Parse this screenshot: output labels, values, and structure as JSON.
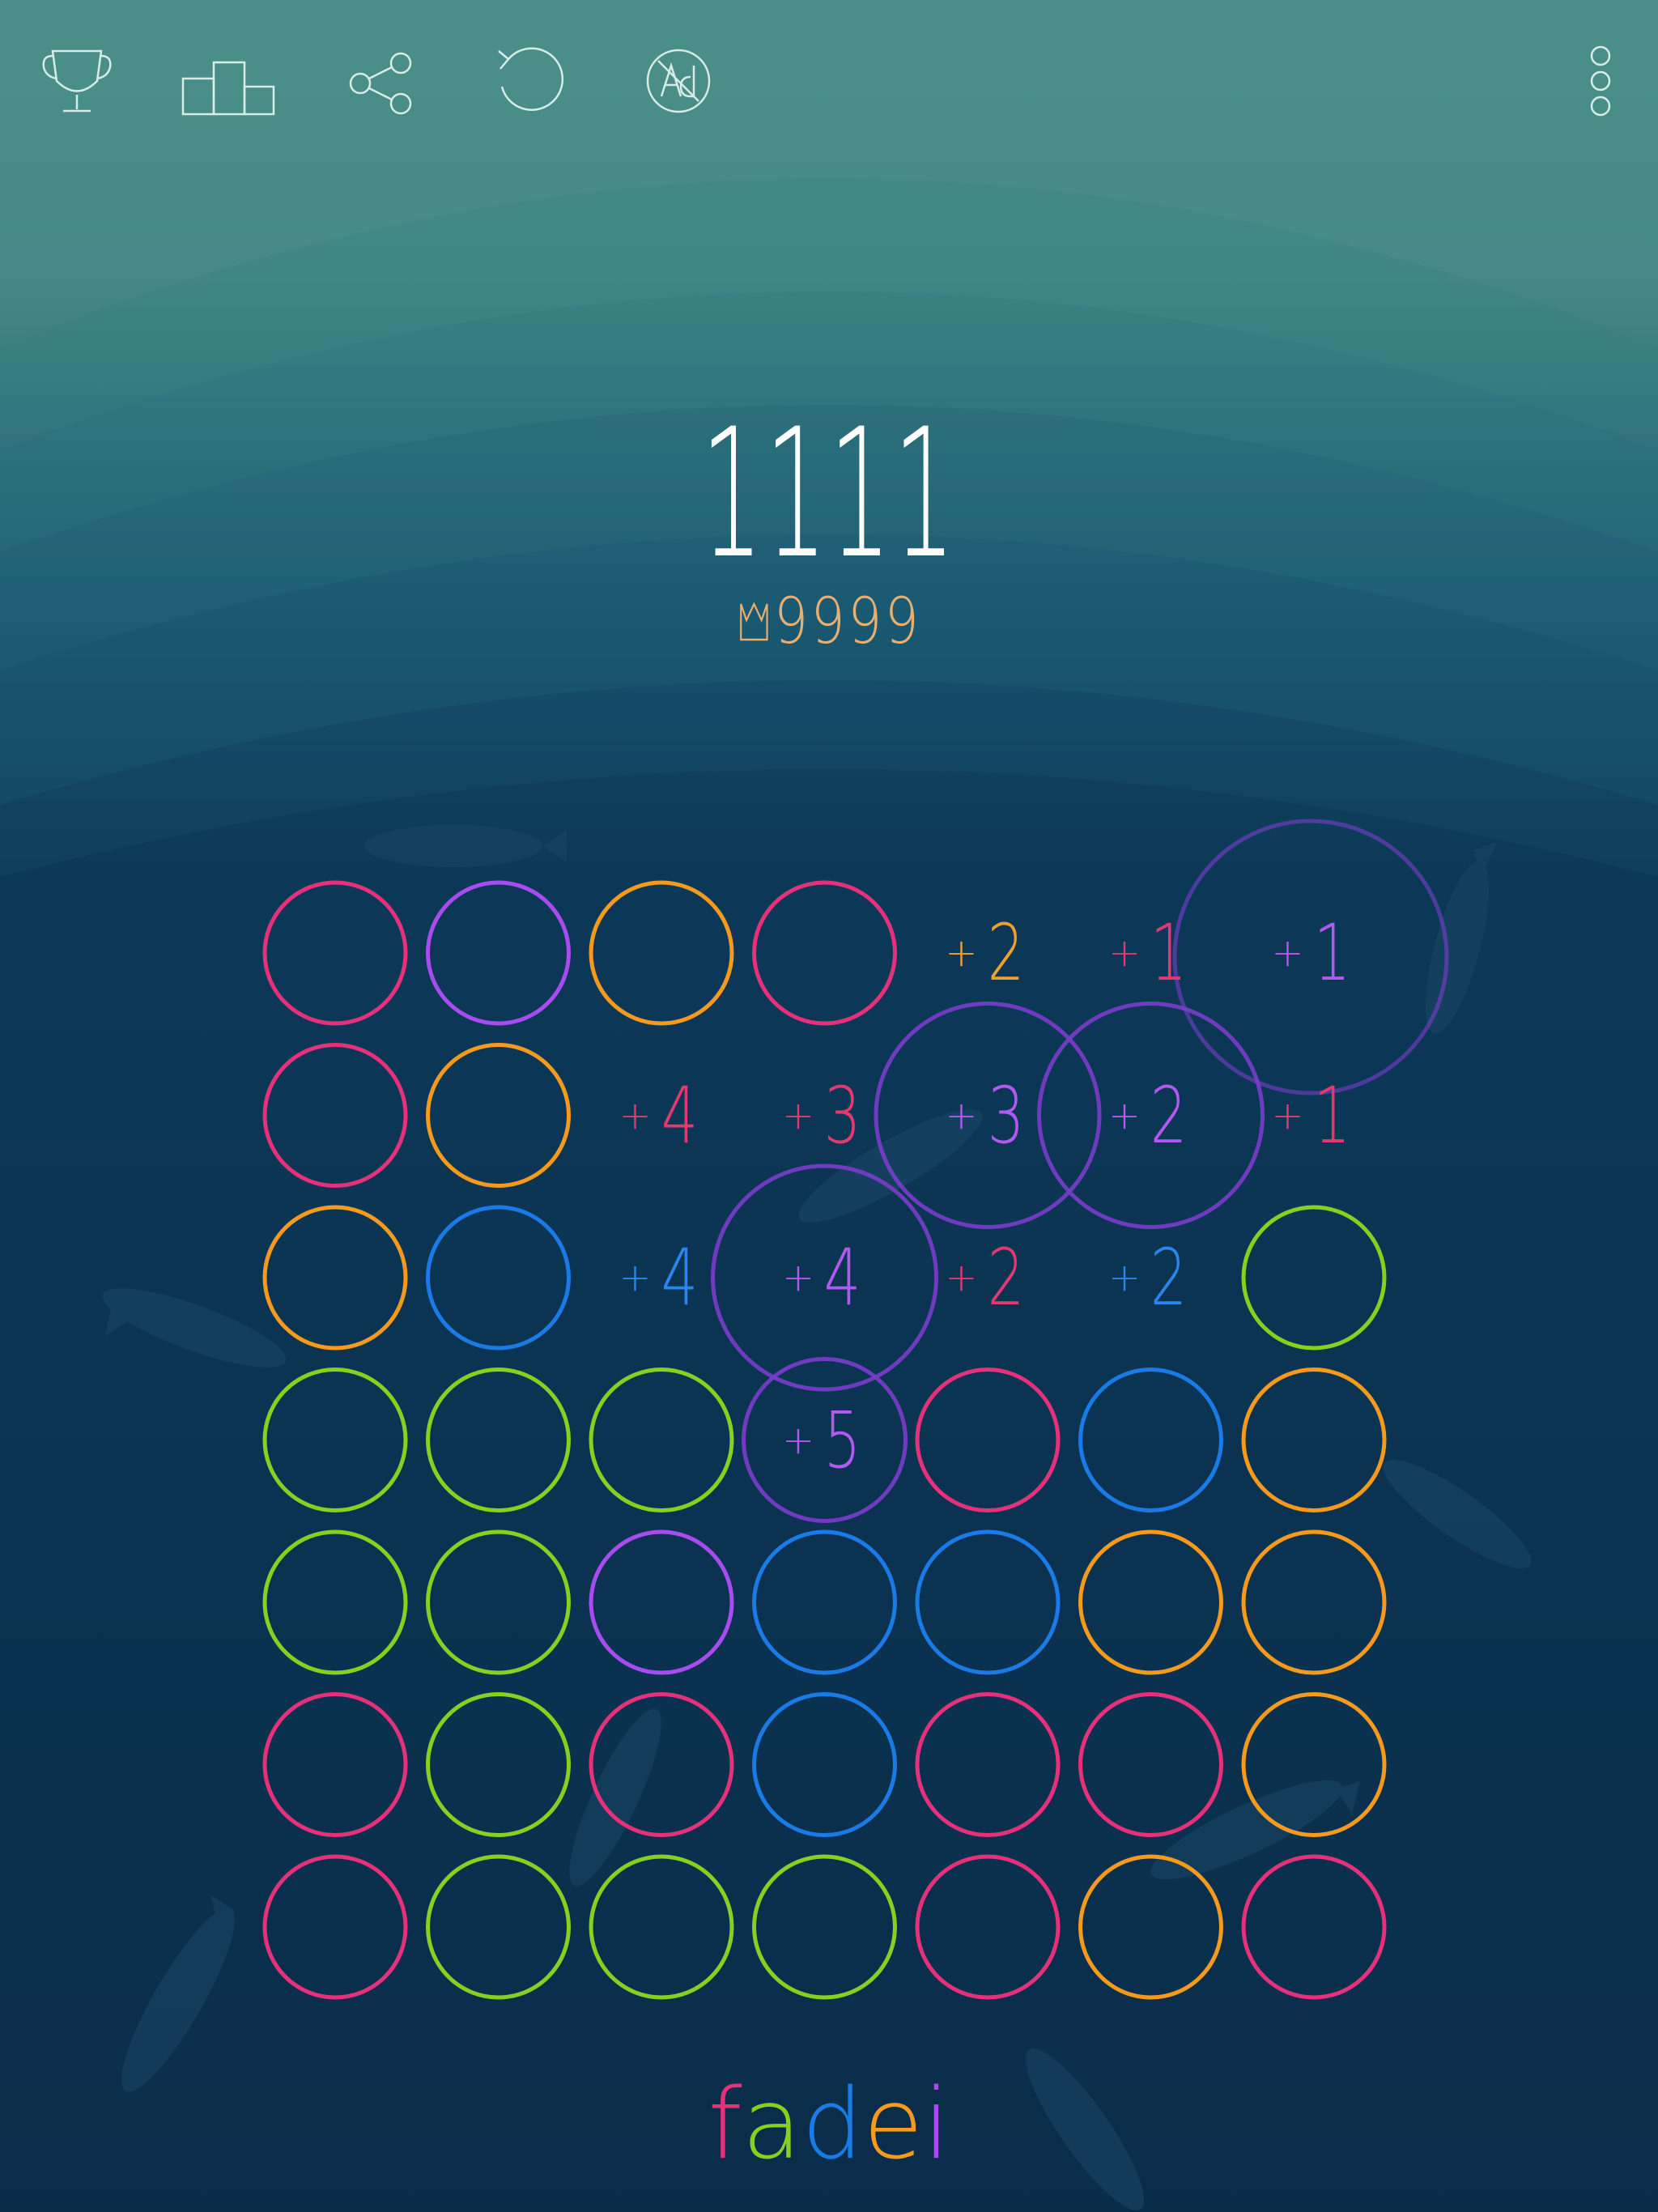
{
  "toolbar": {
    "icons": [
      "trophy-icon",
      "leaderboard-icon",
      "share-icon",
      "restart-icon",
      "no-ads-icon"
    ],
    "menu_icon": "more-vertical-icon",
    "stroke_color": "#d7ece6"
  },
  "score": {
    "current": "1111",
    "best": "9999",
    "best_icon": "crown-icon",
    "best_color": "#e8b070"
  },
  "colors": {
    "pink": "#e5307a",
    "purple": "#a84cf0",
    "orange": "#f59a1c",
    "blue": "#1a7ae6",
    "green": "#86d11f",
    "violet": "#7a3dcc",
    "pink_text": "#e23a6e",
    "orange_text": "#f0a030",
    "blue_text": "#2a86ea",
    "purple_text": "#b25af0"
  },
  "board": {
    "rows": 7,
    "cols": 7,
    "cells": [
      [
        "pink",
        "purple",
        "orange",
        "pink",
        null,
        null,
        null
      ],
      [
        "pink",
        "orange",
        null,
        null,
        null,
        null,
        null
      ],
      [
        "orange",
        "blue",
        null,
        null,
        null,
        null,
        "green"
      ],
      [
        "green",
        "green",
        "green",
        null,
        "pink",
        "blue",
        "orange"
      ],
      [
        "green",
        "green",
        "purple",
        "blue",
        "blue",
        "orange",
        "orange"
      ],
      [
        "pink",
        "green",
        "pink",
        "blue",
        "pink",
        "pink",
        "orange"
      ],
      [
        "pink",
        "green",
        "green",
        "green",
        "pink",
        "orange",
        "pink"
      ]
    ],
    "labels": [
      {
        "row": 0,
        "col": 4,
        "text": "2",
        "color": "orange_text"
      },
      {
        "row": 0,
        "col": 5,
        "text": "1",
        "color": "pink_text"
      },
      {
        "row": 0,
        "col": 6,
        "text": "1",
        "color": "purple_text"
      },
      {
        "row": 1,
        "col": 2,
        "text": "4",
        "color": "pink_text"
      },
      {
        "row": 1,
        "col": 3,
        "text": "3",
        "color": "pink_text"
      },
      {
        "row": 1,
        "col": 4,
        "text": "3",
        "color": "purple_text"
      },
      {
        "row": 1,
        "col": 5,
        "text": "2",
        "color": "purple_text"
      },
      {
        "row": 1,
        "col": 6,
        "text": "1",
        "color": "pink_text"
      },
      {
        "row": 2,
        "col": 2,
        "text": "4",
        "color": "blue_text"
      },
      {
        "row": 2,
        "col": 3,
        "text": "4",
        "color": "purple_text"
      },
      {
        "row": 2,
        "col": 4,
        "text": "2",
        "color": "pink_text"
      },
      {
        "row": 2,
        "col": 5,
        "text": "2",
        "color": "blue_text"
      },
      {
        "row": 3,
        "col": 3,
        "text": "5",
        "color": "purple_text"
      }
    ],
    "fading_rings": [
      {
        "row": 0,
        "col": 6,
        "size": "large"
      },
      {
        "row": 1,
        "col": 4,
        "size": "medium"
      },
      {
        "row": 1,
        "col": 5,
        "size": "medium"
      },
      {
        "row": 2,
        "col": 3,
        "size": "medium"
      },
      {
        "row": 3,
        "col": 3,
        "size": "small"
      }
    ]
  },
  "logo": {
    "letters": [
      {
        "char": "f",
        "color": "pink"
      },
      {
        "char": "a",
        "color": "green"
      },
      {
        "char": "d",
        "color": "blue"
      },
      {
        "char": "e",
        "color": "orange"
      },
      {
        "char": "i",
        "color": "purple"
      }
    ]
  }
}
